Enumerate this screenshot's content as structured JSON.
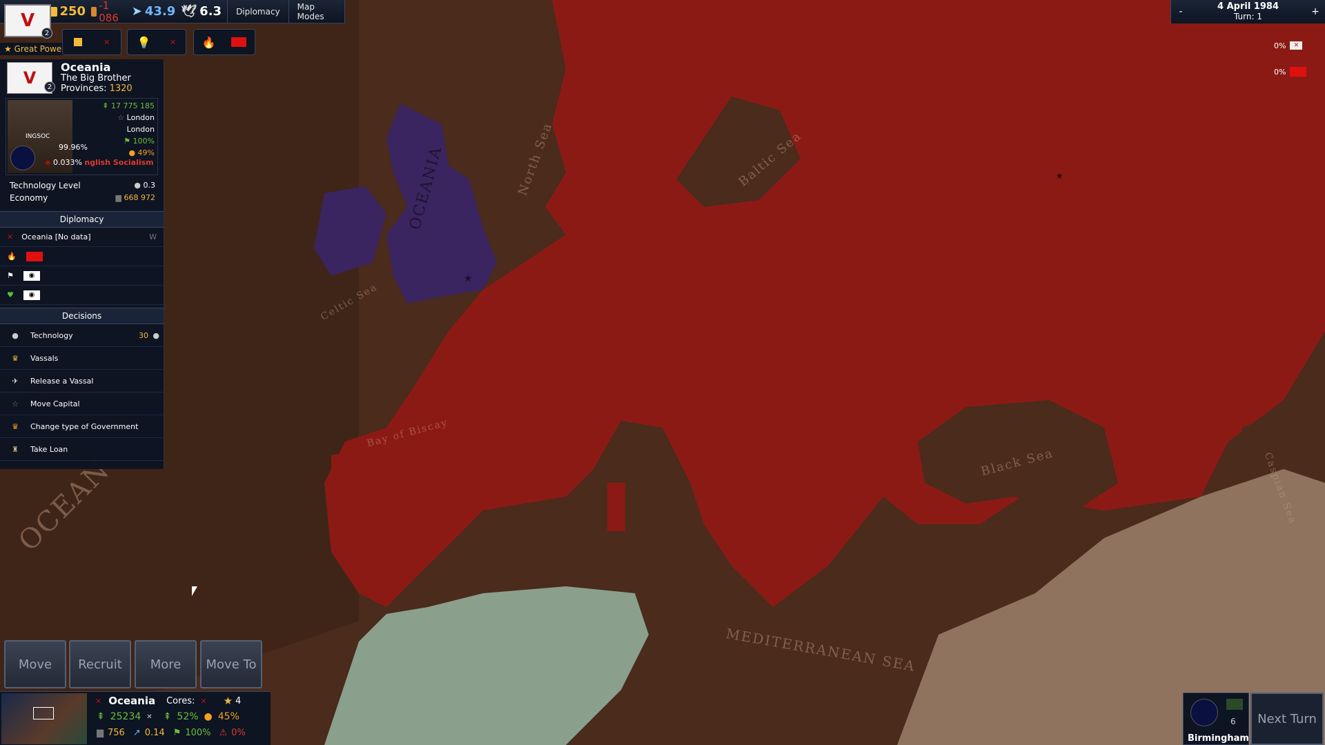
{
  "topbar": {
    "gold": "250",
    "gold_delta": "-1 086",
    "stat_arrow": "43.9",
    "stat_dove": "6.3",
    "diplomacy_btn": "Diplomacy",
    "mapmodes_btn": "Map Modes",
    "flag_level": "2",
    "great_power": "★ Great Power"
  },
  "country": {
    "name": "Oceania",
    "title": "The Big Brother",
    "provinces_label": "Provinces:",
    "provinces_value": "1320",
    "flag_level": "2",
    "population": "17 775 185",
    "capital": "London",
    "city": "London",
    "stability": "100%",
    "happiness": "49%",
    "ideology_share": "99.96%",
    "minor_share": "0.033%",
    "ideology_name": "nglish Socialism",
    "tech_label": "Technology Level",
    "tech_value": "0.3",
    "economy_label": "Economy",
    "economy_value": "668 972",
    "ingsoc_text": "INGSOC"
  },
  "diplomacy": {
    "header": "Diplomacy",
    "rows": [
      {
        "label": "Oceania [No data]"
      }
    ]
  },
  "decisions": {
    "header": "Decisions",
    "items": [
      {
        "label": "Technology",
        "value": "30"
      },
      {
        "label": "Vassals"
      },
      {
        "label": "Release a Vassal"
      },
      {
        "label": "Move Capital"
      },
      {
        "label": "Change type of Government"
      },
      {
        "label": "Take Loan"
      }
    ]
  },
  "actions": {
    "move": "Move",
    "recruit": "Recruit",
    "more": "More",
    "move_to": "Move To"
  },
  "bottom": {
    "country": "Oceania",
    "cores_label": "Cores:",
    "stars": "4",
    "pop": "25234",
    "growth": "52%",
    "happy": "45%",
    "industry": "756",
    "tax": "0.14",
    "stability": "100%",
    "unrest": "0%"
  },
  "topright": {
    "minus": "-",
    "plus": "+",
    "date": "4 April 1984",
    "turn": "Turn: 1",
    "pct1": "0%",
    "pct2": "0%"
  },
  "city": {
    "name": "Birmingham",
    "count": "6"
  },
  "next_turn": "Next Turn",
  "map_labels": {
    "oceania": "OCEANIA",
    "north_sea": "North Sea",
    "baltic": "Baltic Sea",
    "celtic": "Celtic Sea",
    "biscay": "Bay of Biscay",
    "black": "Black Sea",
    "caspian": "Caspian Sea",
    "med": "MEDITERRANEAN SEA",
    "ocean": "OCEAN"
  },
  "colors": {
    "enemy_red": "#8c1a14",
    "oceania_purple": "#3a2560",
    "land_brown": "#4a2b1c",
    "panel": "#0d1422",
    "gold": "#f5b93c"
  }
}
